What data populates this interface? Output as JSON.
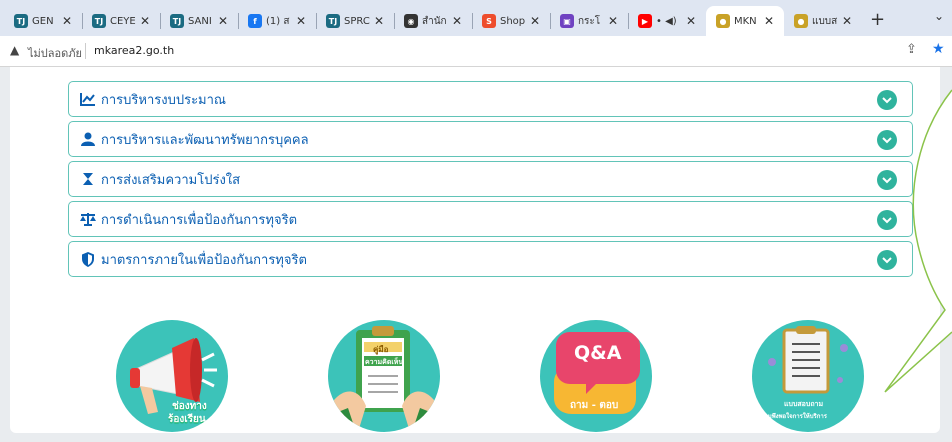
{
  "browser": {
    "tabs": [
      {
        "label": "GEN",
        "color": "#1b6b82",
        "mark": "TJ"
      },
      {
        "label": "CEYE",
        "color": "#1b6b82",
        "mark": "TJ"
      },
      {
        "label": "SANI",
        "color": "#1b6b82",
        "mark": "TJ"
      },
      {
        "label": "(1) ส",
        "color": "#1877f2",
        "mark": "f"
      },
      {
        "label": "SPRC",
        "color": "#1b6b82",
        "mark": "TJ"
      },
      {
        "label": "สำนัก",
        "color": "#333333",
        "mark": "◉"
      },
      {
        "label": "Shop",
        "color": "#ee4d2d",
        "mark": "S"
      },
      {
        "label": "กระโ",
        "color": "#6f42c1",
        "mark": "▣"
      },
      {
        "label": "• ◀)",
        "color": "#ff0000",
        "mark": "▶"
      },
      {
        "label": "MKN",
        "color": "#c9a227",
        "mark": "●"
      },
      {
        "label": "แบบส",
        "color": "#c9a227",
        "mark": "●"
      }
    ],
    "new_tab_label": "+",
    "tab_menu_label": "⌄",
    "address": {
      "insecure_label": "ไม่ปลอดภัย",
      "url": "mkarea2.go.th"
    }
  },
  "accordion": [
    {
      "label": "การบริหารงบประมาณ",
      "icon": "chart-line-icon"
    },
    {
      "label": "การบริหารและพัฒนาทรัพยากรบุคคล",
      "icon": "user-icon"
    },
    {
      "label": "การส่งเสริมความโปร่งใส",
      "icon": "hourglass-icon"
    },
    {
      "label": "การดำเนินการเพื่อป้องกันการทุจริต",
      "icon": "scale-icon"
    },
    {
      "label": "มาตรการภายในเพื่อป้องกันการทุจริต",
      "icon": "shield-icon"
    }
  ],
  "services": {
    "complaint": {
      "line1": "ช่องทาง",
      "line2": "ร้องเรียน"
    },
    "manual": {
      "top": "คู่มือ",
      "sub": "ความคิดเห็น"
    },
    "qa": {
      "big": "Q&A",
      "small": "ถาม - ตอบ"
    },
    "survey": {
      "line1": "แบบสอบถาม",
      "line2": "ความพึงพอใจการให้บริการ"
    }
  },
  "colors": {
    "accent": "#2fb39d",
    "link": "#0b5fb2",
    "teal_circle": "#3cc3b9",
    "callout_stroke": "#8bc34a"
  }
}
